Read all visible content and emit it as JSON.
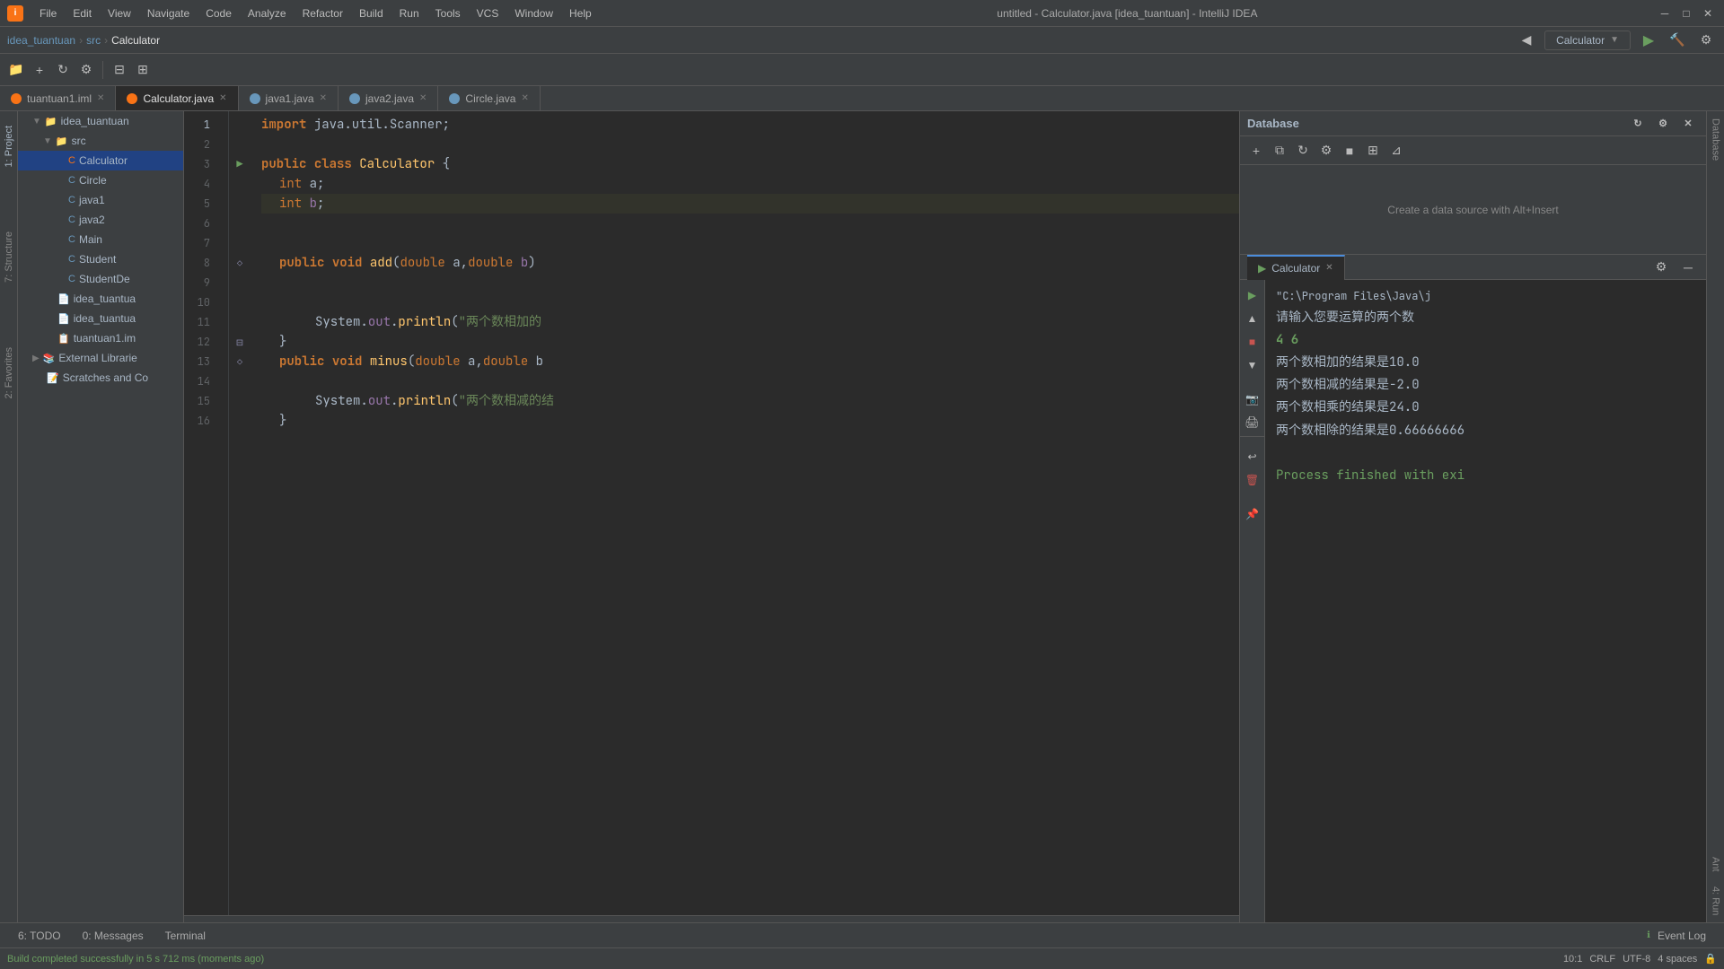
{
  "titlebar": {
    "app_name": "idea",
    "title": "untitled - Calculator.java [idea_tuantuan] - IntelliJ IDEA",
    "menu_items": [
      "File",
      "Edit",
      "View",
      "Navigate",
      "Code",
      "Analyze",
      "Refactor",
      "Build",
      "Run",
      "Tools",
      "VCS",
      "Window",
      "Help"
    ]
  },
  "navbar": {
    "breadcrumb": [
      "idea_tuantuan",
      "src",
      "Calculator"
    ],
    "run_config": "Calculator"
  },
  "tabs": [
    {
      "label": "tuantuan1.iml",
      "icon": "orange",
      "active": false
    },
    {
      "label": "Calculator.java",
      "icon": "orange",
      "active": true
    },
    {
      "label": "java1.java",
      "icon": "blue",
      "active": false
    },
    {
      "label": "java2.java",
      "icon": "blue",
      "active": false
    },
    {
      "label": "Circle.java",
      "icon": "blue",
      "active": false
    }
  ],
  "sidebar": {
    "title": "1: Project",
    "items": [
      {
        "label": "idea_tuantuan",
        "indent": 1,
        "type": "project",
        "expanded": true
      },
      {
        "label": "src",
        "indent": 2,
        "type": "folder",
        "expanded": true
      },
      {
        "label": "Calculator",
        "indent": 3,
        "type": "class-orange",
        "active": true
      },
      {
        "label": "Circle",
        "indent": 3,
        "type": "class-blue"
      },
      {
        "label": "java1",
        "indent": 3,
        "type": "class-blue"
      },
      {
        "label": "java2",
        "indent": 3,
        "type": "class-blue"
      },
      {
        "label": "Main",
        "indent": 3,
        "type": "class-blue"
      },
      {
        "label": "Student",
        "indent": 3,
        "type": "class-blue"
      },
      {
        "label": "StudentDe",
        "indent": 3,
        "type": "class-blue"
      },
      {
        "label": "idea_tuantua",
        "indent": 2,
        "type": "file"
      },
      {
        "label": "idea_tuantua",
        "indent": 2,
        "type": "file"
      },
      {
        "label": "tuantuan1.im",
        "indent": 2,
        "type": "file"
      },
      {
        "label": "External Librarie",
        "indent": 1,
        "type": "library",
        "expanded": false
      },
      {
        "label": "Scratches and Co",
        "indent": 1,
        "type": "scratches"
      }
    ]
  },
  "code": {
    "lines": [
      {
        "num": 1,
        "content": "import java.util.Scanner;",
        "highlight": false
      },
      {
        "num": 2,
        "content": "",
        "highlight": false
      },
      {
        "num": 3,
        "content": "public class Calculator {",
        "highlight": false
      },
      {
        "num": 4,
        "content": "    int a;",
        "highlight": false
      },
      {
        "num": 5,
        "content": "    int b;",
        "highlight": true
      },
      {
        "num": 6,
        "content": "",
        "highlight": false
      },
      {
        "num": 7,
        "content": "",
        "highlight": false
      },
      {
        "num": 8,
        "content": "    public void add(double a,double b)",
        "highlight": false
      },
      {
        "num": 9,
        "content": "",
        "highlight": false
      },
      {
        "num": 10,
        "content": "",
        "highlight": false
      },
      {
        "num": 11,
        "content": "        System.out.println(\"两个数相加的",
        "highlight": false
      },
      {
        "num": 12,
        "content": "    }",
        "highlight": false
      },
      {
        "num": 13,
        "content": "    public void minus(double a,double b",
        "highlight": false
      },
      {
        "num": 14,
        "content": "",
        "highlight": false
      },
      {
        "num": 15,
        "content": "        System.out.println(\"两个数相减的结",
        "highlight": false
      },
      {
        "num": 16,
        "content": "    }",
        "highlight": false
      }
    ]
  },
  "database": {
    "title": "Database",
    "placeholder": "Create a data source with Alt+Insert"
  },
  "run": {
    "title": "Calculator",
    "output": [
      {
        "text": "\"C:\\Program Files\\Java\\j",
        "class": "path"
      },
      {
        "text": "请输入您要运算的两个数",
        "class": "input-prompt"
      },
      {
        "text": "4 6",
        "class": "user-input"
      },
      {
        "text": "两个数相加的结果是10.0",
        "class": "result"
      },
      {
        "text": "两个数相减的结果是-2.0",
        "class": "result"
      },
      {
        "text": "两个数相乘的结果是24.0",
        "class": "result"
      },
      {
        "text": "两个数相除的结果是0.66666666",
        "class": "result"
      },
      {
        "text": "",
        "class": "result"
      },
      {
        "text": "Process finished with exi",
        "class": "process"
      }
    ]
  },
  "statusbar": {
    "build_message": "Build completed successfully in 5 s 712 ms (moments ago)",
    "position": "10:1",
    "line_sep": "CRLF",
    "encoding": "UTF-8",
    "indent": "4 spaces"
  },
  "bottom_tabs": [
    {
      "label": "6: TODO",
      "badge": ""
    },
    {
      "label": "0: Messages",
      "badge": ""
    },
    {
      "label": "Terminal",
      "badge": ""
    }
  ]
}
